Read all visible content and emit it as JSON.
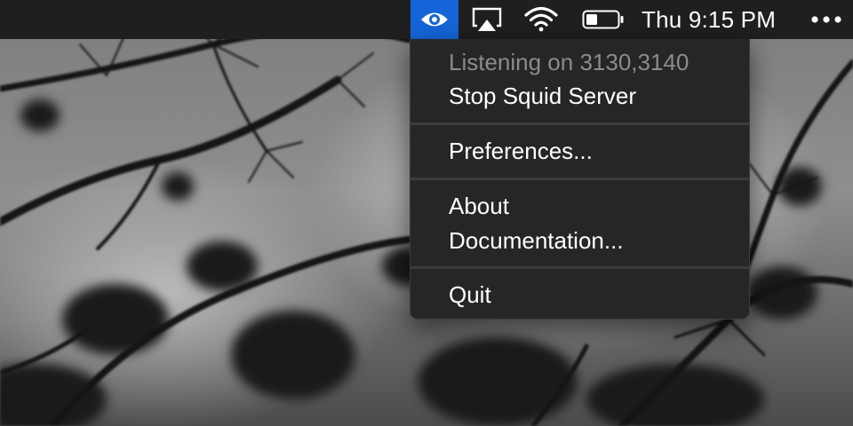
{
  "menubar": {
    "clock": "Thu 9:15 PM",
    "icons": [
      "eye-icon",
      "airplay-icon",
      "wifi-icon",
      "battery-icon",
      "more-icon"
    ],
    "accent_color": "#1565d8"
  },
  "menu": {
    "status": "Listening on 3130,3140",
    "stop_server": "Stop Squid Server",
    "preferences": "Preferences...",
    "about": "About",
    "documentation": "Documentation...",
    "quit": "Quit"
  }
}
